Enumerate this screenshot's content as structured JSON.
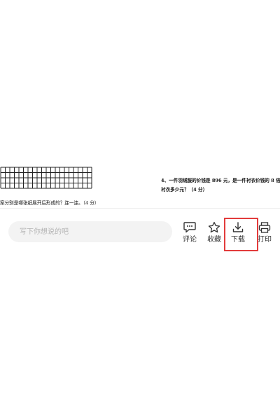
{
  "document": {
    "question4_line1": "4、一件羽绒服的价钱是 896 元，是一件衬衣价钱的 8 倍，",
    "question4_line2": "衬衣多少元？（4 分）",
    "left_question_text": "案分别是哪张纸展开后形成的？连一连。（4 分）"
  },
  "comment_box": {
    "placeholder": "写下你想说的吧",
    "value": ""
  },
  "actions": {
    "comment": {
      "label": "评论",
      "icon": "comment-icon"
    },
    "favorite": {
      "label": "收藏",
      "icon": "star-icon"
    },
    "download": {
      "label": "下载",
      "icon": "download-icon"
    },
    "print": {
      "label": "打印",
      "icon": "printer-icon"
    }
  },
  "highlight_color": "#e23b3b"
}
